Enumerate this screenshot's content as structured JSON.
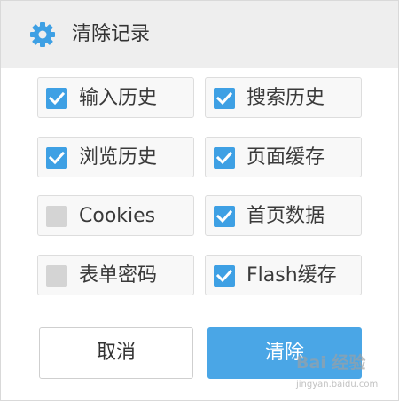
{
  "dialog": {
    "title": "清除记录",
    "accent_color": "#3ea0e4",
    "options": [
      {
        "label": "输入历史",
        "checked": true
      },
      {
        "label": "搜索历史",
        "checked": true
      },
      {
        "label": "浏览历史",
        "checked": true
      },
      {
        "label": "页面缓存",
        "checked": true
      },
      {
        "label": "Cookies",
        "checked": false
      },
      {
        "label": "首页数据",
        "checked": true
      },
      {
        "label": "表单密码",
        "checked": false
      },
      {
        "label": "Flash缓存",
        "checked": true
      }
    ],
    "cancel_label": "取消",
    "clear_label": "清除"
  },
  "watermark": {
    "main": "Bai 经验",
    "sub": "jingyan.baidu.com"
  }
}
